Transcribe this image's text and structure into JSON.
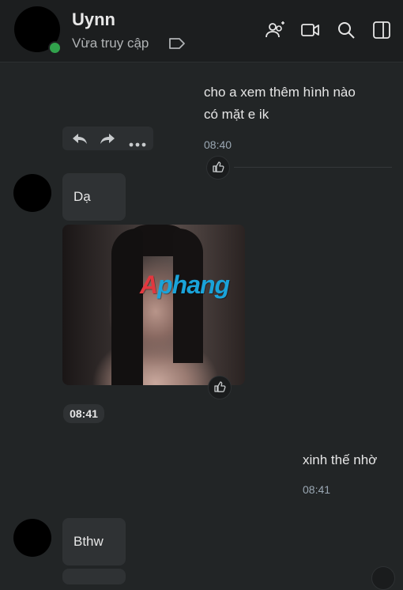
{
  "header": {
    "contact_name": "Uynn",
    "status": "Vừa truy cập",
    "icons": [
      "add-group-icon",
      "video-call-icon",
      "search-icon",
      "sidebar-toggle-icon"
    ]
  },
  "messages": {
    "m1": {
      "line1": "cho a xem thêm hình nào",
      "line2": "có mặt e ik",
      "time": "08:40"
    },
    "m2": {
      "text": "Dạ"
    },
    "m3": {
      "watermark_a": "A",
      "watermark_b": "phang",
      "time": "08:41"
    },
    "m4": {
      "text": "xinh thế nhờ",
      "time": "08:41"
    },
    "m5": {
      "text": "Bthw"
    }
  },
  "colors": {
    "background": "#222526",
    "header": "#1c1e1f",
    "bubble": "#2f3234",
    "online": "#31a24c",
    "time_text": "#9aa7b3"
  }
}
